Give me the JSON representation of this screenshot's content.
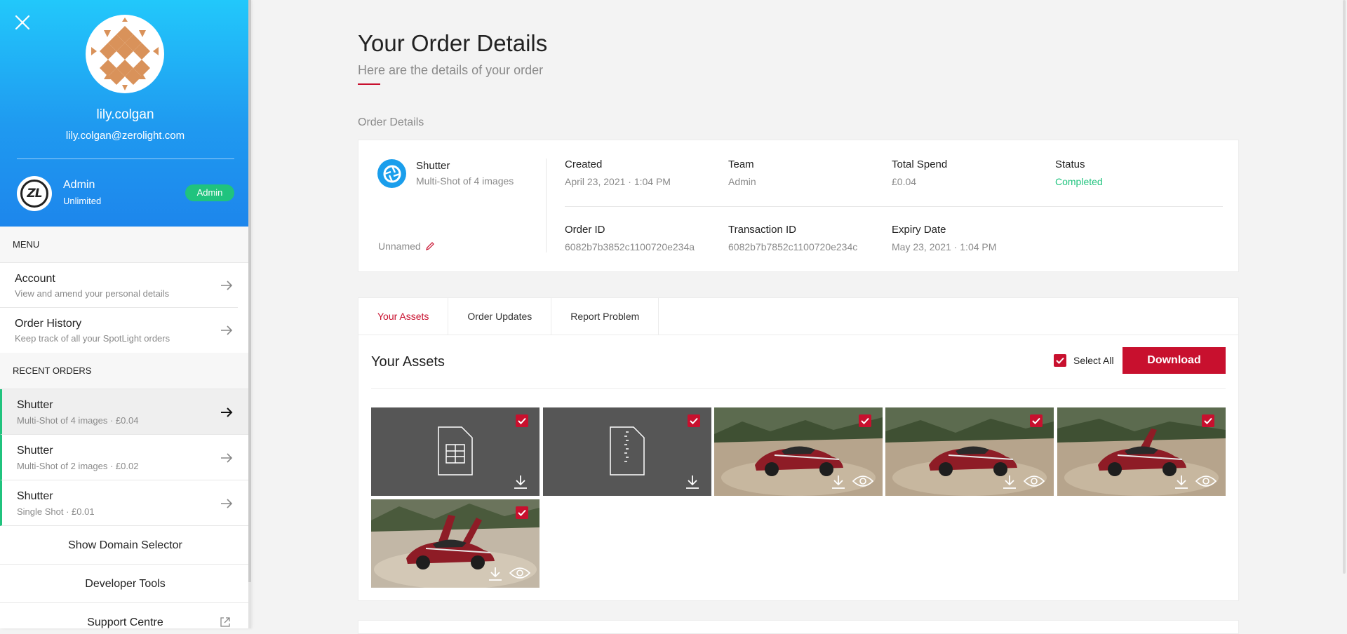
{
  "profile": {
    "username": "lily.colgan",
    "email": "lily.colgan@zerolight.com",
    "role_name": "Admin",
    "role_sub": "Unlimited",
    "role_badge": "Admin"
  },
  "menu": {
    "title": "MENU",
    "items": [
      {
        "title": "Account",
        "sub": "View and amend your personal details"
      },
      {
        "title": "Order History",
        "sub": "Keep track of all your SpotLight orders"
      }
    ]
  },
  "recent_orders": {
    "title": "RECENT ORDERS",
    "items": [
      {
        "title": "Shutter",
        "sub": "Multi-Shot of 4 images · £0.04"
      },
      {
        "title": "Shutter",
        "sub": "Multi-Shot of 2 images · £0.02"
      },
      {
        "title": "Shutter",
        "sub": "Single Shot · £0.01"
      }
    ]
  },
  "sidebar_buttons": {
    "domain_selector": "Show Domain Selector",
    "developer_tools": "Developer Tools",
    "support_centre": "Support Centre"
  },
  "header": {
    "title": "Your Order Details",
    "subtitle": "Here are the details of your order"
  },
  "order": {
    "section_label": "Order Details",
    "product_name": "Shutter",
    "product_sub": "Multi-Shot of 4 images",
    "name_label": "Unnamed",
    "fields": {
      "created": {
        "label": "Created",
        "value": "April 23, 2021 · 1:04 PM"
      },
      "team": {
        "label": "Team",
        "value": "Admin"
      },
      "total_spend": {
        "label": "Total Spend",
        "value": "£0.04"
      },
      "status": {
        "label": "Status",
        "value": "Completed"
      },
      "order_id": {
        "label": "Order ID",
        "value": "6082b7b3852c1100720e234a"
      },
      "transaction_id": {
        "label": "Transaction ID",
        "value": "6082b7b7852c1100720e234c"
      },
      "expiry_date": {
        "label": "Expiry Date",
        "value": "May 23, 2021 · 1:04 PM"
      }
    }
  },
  "tabs": [
    {
      "label": "Your Assets",
      "active": true
    },
    {
      "label": "Order Updates",
      "active": false
    },
    {
      "label": "Report Problem",
      "active": false
    }
  ],
  "assets": {
    "title": "Your Assets",
    "select_all": "Select All",
    "download": "Download",
    "tiles": [
      {
        "kind": "spreadsheet-file",
        "checked": true
      },
      {
        "kind": "zip-file",
        "checked": true
      },
      {
        "kind": "car-image",
        "checked": true
      },
      {
        "kind": "car-image",
        "checked": true
      },
      {
        "kind": "car-image",
        "checked": true
      },
      {
        "kind": "car-image-doors-open",
        "checked": true
      }
    ]
  },
  "colors": {
    "accent_red": "#c8102e",
    "success_green": "#20c37e",
    "sidebar_blue": "#1f9af0",
    "car_red": "#8e1c26"
  }
}
